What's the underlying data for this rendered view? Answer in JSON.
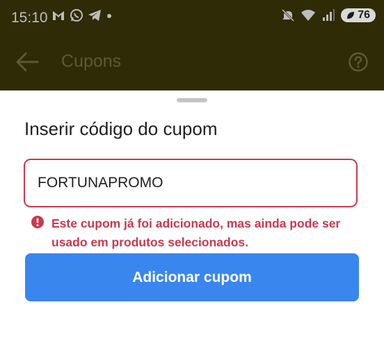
{
  "status_bar": {
    "time": "15:10",
    "battery": "76",
    "icons_left": [
      "gmail-icon",
      "whatsapp-icon",
      "telegram-icon",
      "dot-icon"
    ],
    "icons_right": [
      "mute-icon",
      "wifi-icon",
      "signal-icon",
      "battery-icon"
    ]
  },
  "header": {
    "title": "Cupons",
    "back_icon": "back-arrow-icon",
    "help_icon": "help-icon"
  },
  "sheet": {
    "title": "Inserir código do cupom",
    "coupon_input": {
      "value": "FORTUNAPROMO",
      "placeholder": ""
    },
    "error": {
      "icon": "error-icon",
      "text": "Este cupom já foi adicionado, mas ainda pode ser usado em produtos selecionados."
    },
    "add_button_label": "Adicionar cupom"
  },
  "colors": {
    "accent": "#3a86ef",
    "error": "#c8394e",
    "backdrop": "#2f2b06"
  }
}
